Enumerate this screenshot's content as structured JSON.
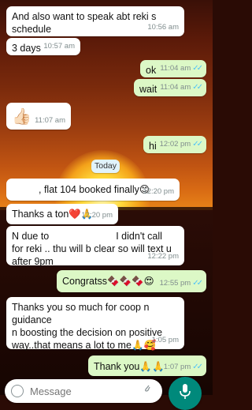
{
  "chat": {
    "messages": [
      {
        "dir": "in",
        "text_line1": "And also want to speak abt reki s",
        "text_line2": "schedule",
        "time": "10:56 am"
      },
      {
        "dir": "in",
        "text": "3 days",
        "time": "10:57 am"
      },
      {
        "dir": "out",
        "text": "ok",
        "time": "11:04 am",
        "read": true
      },
      {
        "dir": "out",
        "text": "wait",
        "time": "11:04 am",
        "read": true
      },
      {
        "dir": "in",
        "emoji": "👍🏻",
        "time": "11:07 am"
      },
      {
        "dir": "out",
        "text": "hi",
        "time": "12:02 pm",
        "read": true
      },
      {
        "dir": "in",
        "text": ", flat 104 booked finally",
        "emoji": "😊",
        "time": "12:20 pm"
      },
      {
        "dir": "in",
        "text": "Thanks a ton",
        "emoji": "❤️🙏",
        "time": "12:20 pm"
      },
      {
        "dir": "in",
        "text_line1a": "N due to",
        "text_line1b": "I didn't call",
        "text_line2": "for reki .. thu will b clear so will text u",
        "text_line3": "after 9pm",
        "time": "12:22 pm"
      },
      {
        "dir": "out",
        "text": "Congratss",
        "emoji": "🍫🍫🍫😍",
        "time": "12:55 pm",
        "read": true
      },
      {
        "dir": "in",
        "text_line1": "Thanks you so much for coop n guidance",
        "text_line2": "n boosting the decision on positive",
        "text_line3": "way..that means a lot to me",
        "emoji": "🙏🥰",
        "time": "1:05 pm"
      },
      {
        "dir": "out",
        "text": "Thank you",
        "emoji": "🙏🙏",
        "time": "1:07 pm",
        "read": true
      }
    ],
    "day_separator": "Today"
  },
  "composer": {
    "placeholder": "Message",
    "icons": [
      "emoji-icon",
      "attach-icon",
      "camera-icon"
    ],
    "send_icon": "microphone-icon"
  },
  "colors": {
    "incoming_bubble": "#ffffff",
    "outgoing_bubble": "#dcf8c6",
    "read_ticks": "#4fc3f7",
    "send_button": "#00897b"
  }
}
